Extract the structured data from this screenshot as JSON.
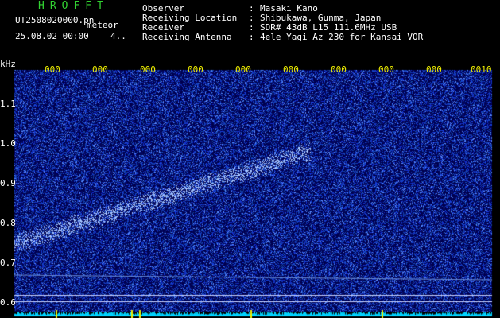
{
  "header": {
    "title": "HROFFT",
    "file_name": "UT2508020000.pn",
    "mode": "meteor",
    "date_time": "25.08.02 00:00",
    "page": "4..",
    "info": [
      {
        "key": "Observer",
        "value": "Masaki Kano"
      },
      {
        "key": "Receiving Location",
        "value": "Shibukawa, Gunma, Japan"
      },
      {
        "key": "Receiver",
        "value": "SDR# 43dB L15 111.6MHz USB"
      },
      {
        "key": "Receiving Antenna",
        "value": "4ele Yagi Az 230 for Kansai VOR"
      }
    ]
  },
  "plot": {
    "y_unit": "kHz",
    "y_ticks": [
      "1.1",
      "1.0",
      "0.9",
      "0.8",
      "0.7",
      "0.6"
    ],
    "x_ticks": [
      "000",
      "000",
      "000",
      "000",
      "000",
      "000",
      "000",
      "000",
      "000",
      "0010"
    ],
    "colors": {
      "background": "#000060",
      "signal": "#8cb4ff",
      "trace": "#00d2ff",
      "tick": "#f0f000"
    }
  }
}
